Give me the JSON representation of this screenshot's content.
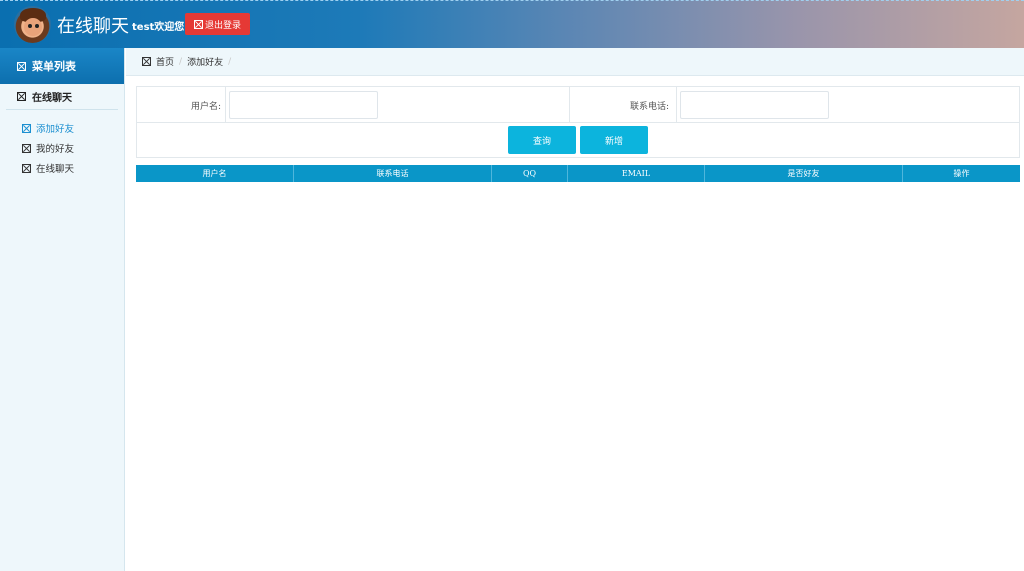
{
  "header": {
    "app_title": "在线聊天",
    "welcome": "test欢迎您!",
    "logout_label": "退出登录"
  },
  "sidebar": {
    "menu_title": "菜单列表",
    "group_label": "在线聊天",
    "items": [
      {
        "label": "添加好友",
        "active": true
      },
      {
        "label": "我的好友",
        "active": false
      },
      {
        "label": "在线聊天",
        "active": false
      }
    ]
  },
  "breadcrumb": {
    "home": "首页",
    "current": "添加好友",
    "separator": "/"
  },
  "search_form": {
    "username_label": "用户名:",
    "username_value": "",
    "phone_label": "联系电话:",
    "phone_value": "",
    "query_button": "查询",
    "add_button": "新增"
  },
  "grid": {
    "columns": [
      "用户名",
      "联系电话",
      "QQ",
      "EMAIL",
      "是否好友",
      "操作"
    ]
  },
  "colors": {
    "accent": "#0cb4dd",
    "table_header": "#0a96c8",
    "logout": "#e53935",
    "active_menu": "#1b8fd0"
  }
}
